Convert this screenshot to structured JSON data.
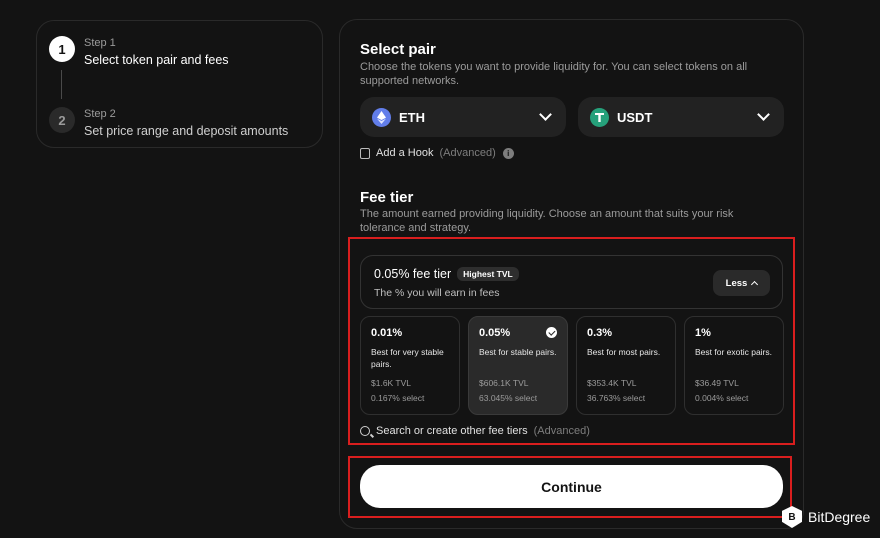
{
  "steps": [
    {
      "number": "1",
      "label": "Step 1",
      "title": "Select token pair and fees"
    },
    {
      "number": "2",
      "label": "Step 2",
      "title": "Set price range and deposit amounts"
    }
  ],
  "select_pair": {
    "title": "Select pair",
    "description": "Choose the tokens you want to provide liquidity for. You can select tokens on all supported networks.",
    "token_a": {
      "symbol": "ETH",
      "icon": "eth-icon",
      "color": "#627eea"
    },
    "token_b": {
      "symbol": "USDT",
      "icon": "tether-icon",
      "color": "#26a17b"
    },
    "hook_label": "Add a Hook",
    "hook_advanced": "(Advanced)"
  },
  "fee_tier": {
    "title": "Fee tier",
    "description": "The amount earned providing liquidity. Choose an amount that suits your risk tolerance and strategy.",
    "current_title": "0.05% fee tier",
    "badge": "Highest TVL",
    "subtitle": "The % you will earn in fees",
    "less_label": "Less",
    "options": [
      {
        "pct": "0.01%",
        "desc": "Best for very stable pairs.",
        "tvl": "$1.6K TVL",
        "select": "0.167% select",
        "selected": false
      },
      {
        "pct": "0.05%",
        "desc": "Best for stable pairs.",
        "tvl": "$606.1K TVL",
        "select": "63.045% select",
        "selected": true
      },
      {
        "pct": "0.3%",
        "desc": "Best for most pairs.",
        "tvl": "$353.4K TVL",
        "select": "36.763% select",
        "selected": false
      },
      {
        "pct": "1%",
        "desc": "Best for exotic pairs.",
        "tvl": "$36.49 TVL",
        "select": "0.004% select",
        "selected": false
      }
    ],
    "search_label": "Search or create other fee tiers",
    "search_advanced": "(Advanced)"
  },
  "continue_label": "Continue",
  "watermark": {
    "logo_letter": "B",
    "text": "BitDegree"
  },
  "colors": {
    "background": "#131313",
    "highlight": "#d91e1e"
  }
}
